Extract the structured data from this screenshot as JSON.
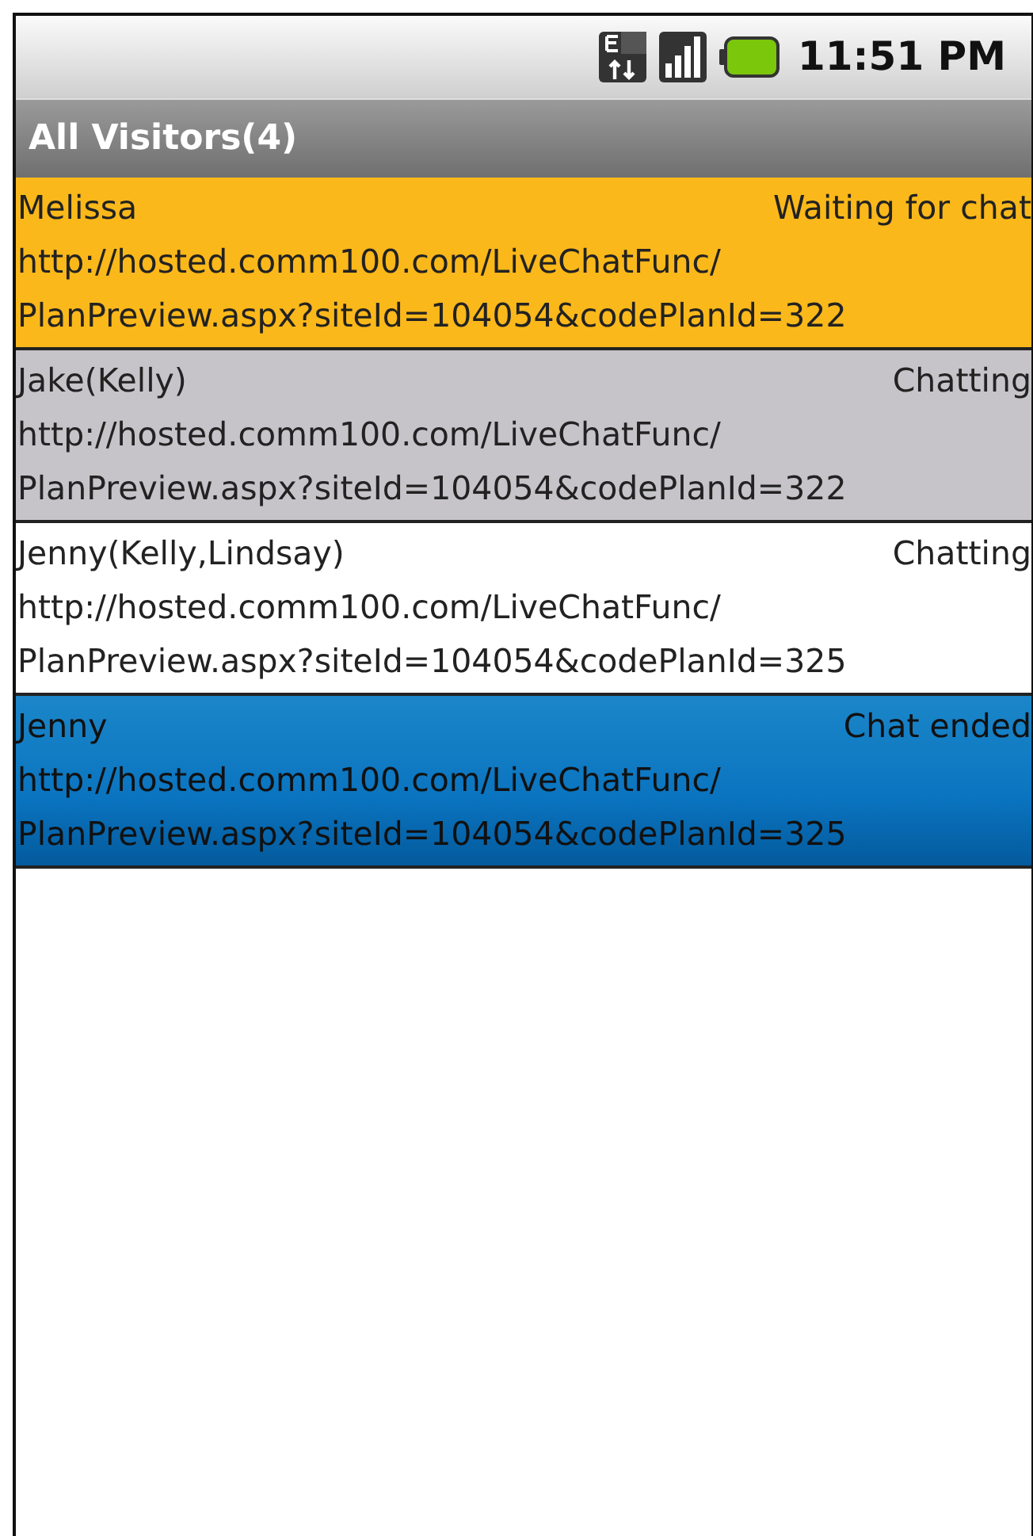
{
  "status_bar": {
    "time": "11:51 PM"
  },
  "title_bar": {
    "title": "All Visitors(4)"
  },
  "visitors": [
    {
      "name": "Melissa",
      "status": "Waiting for chat",
      "url_line_1": "http://hosted.comm100.com/LiveChatFunc/",
      "url_line_2": "PlanPreview.aspx?siteId=104054&codePlanId=322",
      "color": "#fbb81a",
      "selected": false
    },
    {
      "name": "Jake(Kelly)",
      "status": "Chatting",
      "url_line_1": "http://hosted.comm100.com/LiveChatFunc/",
      "url_line_2": "PlanPreview.aspx?siteId=104054&codePlanId=322",
      "color": "#c6c4c8",
      "selected": false
    },
    {
      "name": "Jenny(Kelly,Lindsay)",
      "status": "Chatting",
      "url_line_1": "http://hosted.comm100.com/LiveChatFunc/",
      "url_line_2": "PlanPreview.aspx?siteId=104054&codePlanId=325",
      "color": "#ffffff",
      "selected": false
    },
    {
      "name": "Jenny",
      "status": "Chat ended",
      "url_line_1": "http://hosted.comm100.com/LiveChatFunc/",
      "url_line_2": "PlanPreview.aspx?siteId=104054&codePlanId=325",
      "color": "#0a74c0",
      "selected": true
    }
  ]
}
